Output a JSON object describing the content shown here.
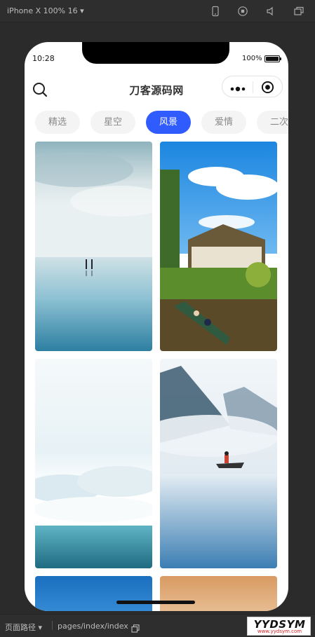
{
  "devtools": {
    "device_label": "iPhone X 100% 16 ▾",
    "icons": [
      "phone-icon",
      "record-icon",
      "volume-icon",
      "window-icon"
    ]
  },
  "status_bar": {
    "time": "10:28",
    "battery": "100%"
  },
  "nav": {
    "title": "刀客源码网",
    "search_icon": "search-icon",
    "more_icon": "more-icon",
    "close_icon": "target-icon"
  },
  "tabs": [
    {
      "label": "精选",
      "active": false
    },
    {
      "label": "星空",
      "active": false
    },
    {
      "label": "风景",
      "active": true
    },
    {
      "label": "爱情",
      "active": false
    },
    {
      "label": "二次",
      "active": false
    }
  ],
  "accent_color": "#2f5bff",
  "wallpapers": [
    {
      "name": "sea-horizon-people",
      "palette": [
        "#c9dbe0",
        "#6aa9c3"
      ]
    },
    {
      "name": "village-boat",
      "palette": [
        "#2f8fe0",
        "#4a7a2a"
      ]
    },
    {
      "name": "ocean-clouds",
      "palette": [
        "#f2f7f8",
        "#2f7d92"
      ]
    },
    {
      "name": "misty-lake-boat",
      "palette": [
        "#dfe9f1",
        "#3c7eb3"
      ]
    },
    {
      "name": "blue-ocean",
      "palette": [
        "#1a6fbf"
      ]
    },
    {
      "name": "sunset-sky",
      "palette": [
        "#d99a62"
      ]
    }
  ],
  "bottombar": {
    "path_label": "页面路径 ▾",
    "path_value": "pages/index/index"
  },
  "watermark": {
    "main": "YYDSYM",
    "sub": "www.yydsym.com"
  }
}
